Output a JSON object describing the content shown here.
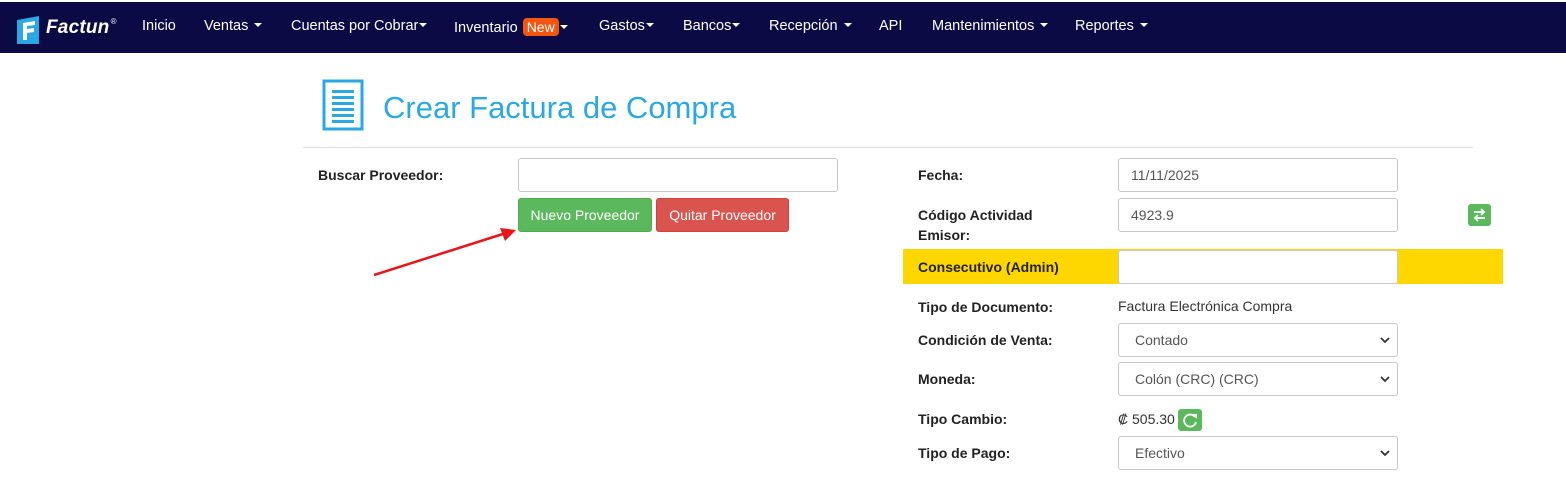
{
  "nav": {
    "brand": "Factun",
    "brand_reg": "®",
    "items": [
      {
        "label": "Inicio"
      },
      {
        "label": "Ventas"
      },
      {
        "label": "Cuentas por Cobrar"
      },
      {
        "label": "Inventario",
        "badge": "New"
      },
      {
        "label": "Gastos"
      },
      {
        "label": "Bancos"
      },
      {
        "label": "Recepción"
      },
      {
        "label": "API"
      },
      {
        "label": "Mantenimientos"
      },
      {
        "label": "Reportes"
      }
    ],
    "colors": {
      "background": "#0b0a44",
      "badge": "#f2560f"
    }
  },
  "page": {
    "title": "Crear Factura de Compra",
    "title_color": "#2aa8e3",
    "icon": "document-list-icon"
  },
  "left": {
    "search_label": "Buscar Proveedor:",
    "search_value": "",
    "new_button": "Nuevo Proveedor",
    "remove_button": "Quitar Proveedor"
  },
  "right": {
    "fecha_label": "Fecha:",
    "fecha_value": "11/11/2025",
    "actividad_label_1": "Código Actividad",
    "actividad_label_2": "Emisor:",
    "actividad_value": "4923.9",
    "consecutivo_label": "Consecutivo (Admin)",
    "consecutivo_value": "",
    "tipo_doc_label": "Tipo de Documento:",
    "tipo_doc_value": "Factura Electrónica Compra",
    "condicion_label": "Condición de Venta:",
    "condicion_value": "Contado",
    "moneda_label": "Moneda:",
    "moneda_value": "Colón (CRC) (CRC)",
    "tipo_cambio_label": "Tipo Cambio:",
    "tipo_cambio_value": "₡ 505.30",
    "tipo_pago_label": "Tipo de Pago:",
    "tipo_pago_value": "Efectivo",
    "highlight_color": "#ffd700"
  }
}
